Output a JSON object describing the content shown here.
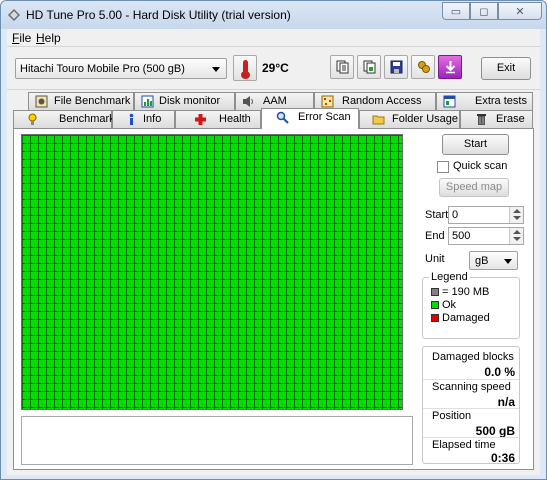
{
  "window": {
    "title": "HD Tune Pro 5.00 - Hard Disk Utility (trial version)",
    "caption": {
      "minimize": "▭",
      "maximize": "◻",
      "close": "✕"
    }
  },
  "menu": {
    "file_label": "File",
    "file_accel": "F",
    "file_rest": "ile",
    "help_accel": "H",
    "help_rest": "elp"
  },
  "toolbar": {
    "drive": "Hitachi Touro Mobile Pro (500 gB)",
    "temperature": "29°C",
    "buttons": [
      "copy-text-icon",
      "copy-screenshot-icon",
      "save-icon",
      "options-icon",
      "download-icon"
    ],
    "exit_label": "Exit"
  },
  "tabs": {
    "row1": [
      {
        "label": "File Benchmark",
        "icon": "file-benchmark-icon"
      },
      {
        "label": "Disk monitor",
        "icon": "disk-monitor-icon"
      },
      {
        "label": "AAM",
        "icon": "speaker-icon"
      },
      {
        "label": "Random Access",
        "icon": "random-access-icon"
      },
      {
        "label": "Extra tests",
        "icon": "extra-tests-icon"
      }
    ],
    "row2": [
      {
        "label": "Benchmark",
        "icon": "benchmark-icon"
      },
      {
        "label": "Info",
        "icon": "info-icon"
      },
      {
        "label": "Health",
        "icon": "health-cross-icon"
      },
      {
        "label": "Error Scan",
        "icon": "magnifier-icon",
        "active": true
      },
      {
        "label": "Folder Usage",
        "icon": "folder-icon"
      },
      {
        "label": "Erase",
        "icon": "trash-icon"
      }
    ]
  },
  "scan": {
    "start_label": "Start",
    "quick_scan_label": "Quick scan",
    "quick_scan_checked": false,
    "speed_map_label": "Speed map",
    "start_field_label": "Start",
    "start_value": "0",
    "end_field_label": "End",
    "end_value": "500",
    "unit_label": "Unit",
    "unit_value": "gB",
    "block_state": "all blocks ok"
  },
  "legend": {
    "title": "Legend",
    "block_size": "= 190 MB",
    "ok_label": "Ok",
    "damaged_label": "Damaged",
    "colors": {
      "block": "#808080",
      "ok": "#00e000",
      "damaged": "#e00000"
    }
  },
  "stats": {
    "damaged_blocks_label": "Damaged blocks",
    "damaged_blocks_value": "0.0 %",
    "scanning_speed_label": "Scanning speed",
    "scanning_speed_value": "n/a",
    "position_label": "Position",
    "position_value": "500 gB",
    "elapsed_time_label": "Elapsed time",
    "elapsed_time_value": "0:36"
  }
}
